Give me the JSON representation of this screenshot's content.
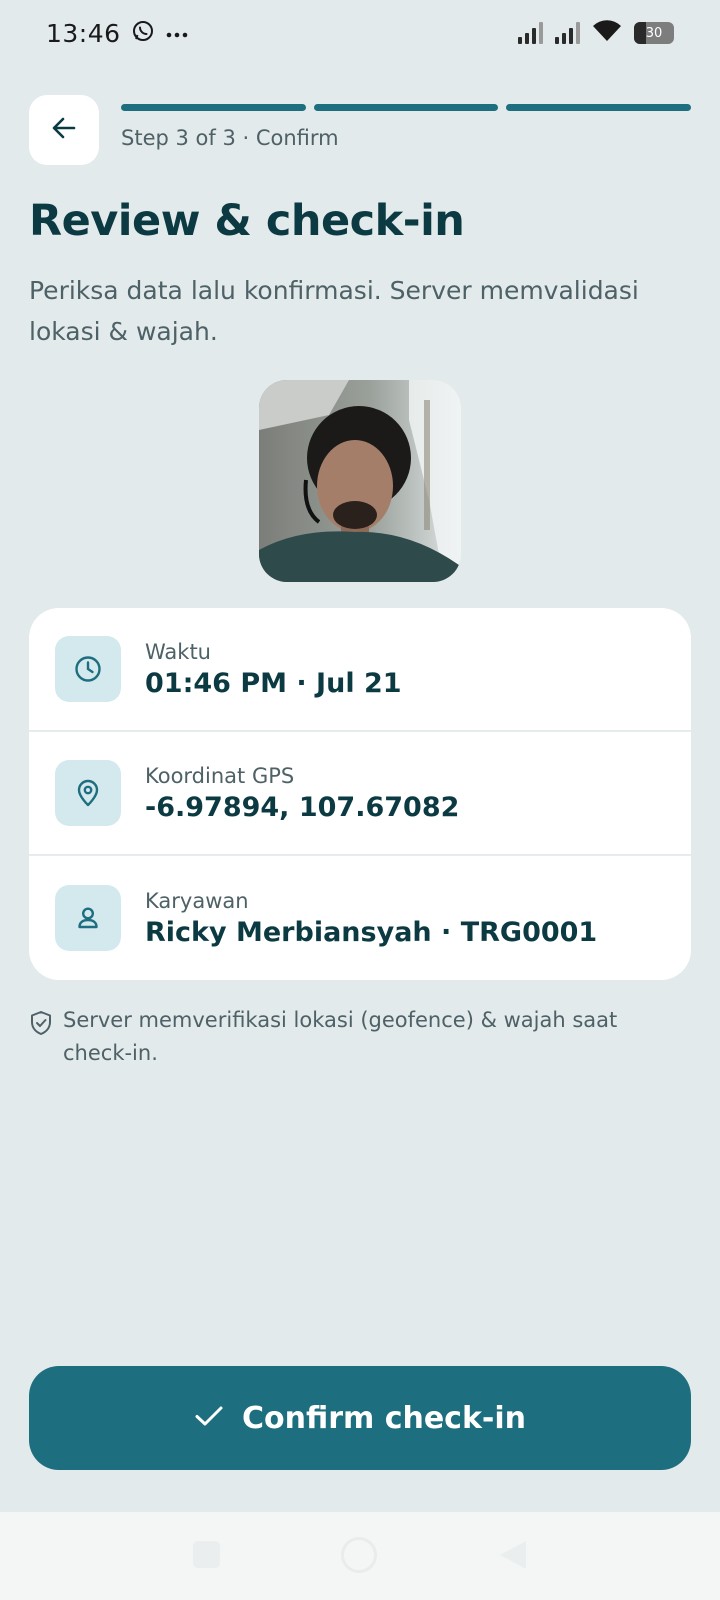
{
  "status_bar": {
    "time": "13:46",
    "battery": "30",
    "icons": [
      "whatsapp-icon",
      "more-dots-icon",
      "signal-icon",
      "signal-icon",
      "wifi-icon",
      "battery-icon"
    ]
  },
  "header": {
    "back_icon": "arrow-left-icon",
    "progress_steps": 3,
    "progress_completed": 3,
    "step_label": "Step 3 of 3 · Confirm"
  },
  "page": {
    "title": "Review & check-in",
    "subtitle": "Periksa data lalu konfirmasi. Server memvalidasi lokasi & wajah."
  },
  "details": [
    {
      "icon": "clock-icon",
      "label": "Waktu",
      "value": "01:46 PM · Jul 21"
    },
    {
      "icon": "location-pin-icon",
      "label": "Koordinat GPS",
      "value": "-6.97894, 107.67082"
    },
    {
      "icon": "user-icon",
      "label": "Karyawan",
      "value": "Ricky Merbiansyah · TRG0001"
    }
  ],
  "note": {
    "icon": "shield-check-icon",
    "text": "Server memverifikasi lokasi (geofence) & wajah saat check-in."
  },
  "confirm_button": {
    "icon": "check-icon",
    "label": "Confirm check-in"
  },
  "colors": {
    "background": "#e2eaec",
    "accent": "#1d6e7e",
    "icon_bg": "#d4e9ee",
    "title": "#0c3a42"
  }
}
